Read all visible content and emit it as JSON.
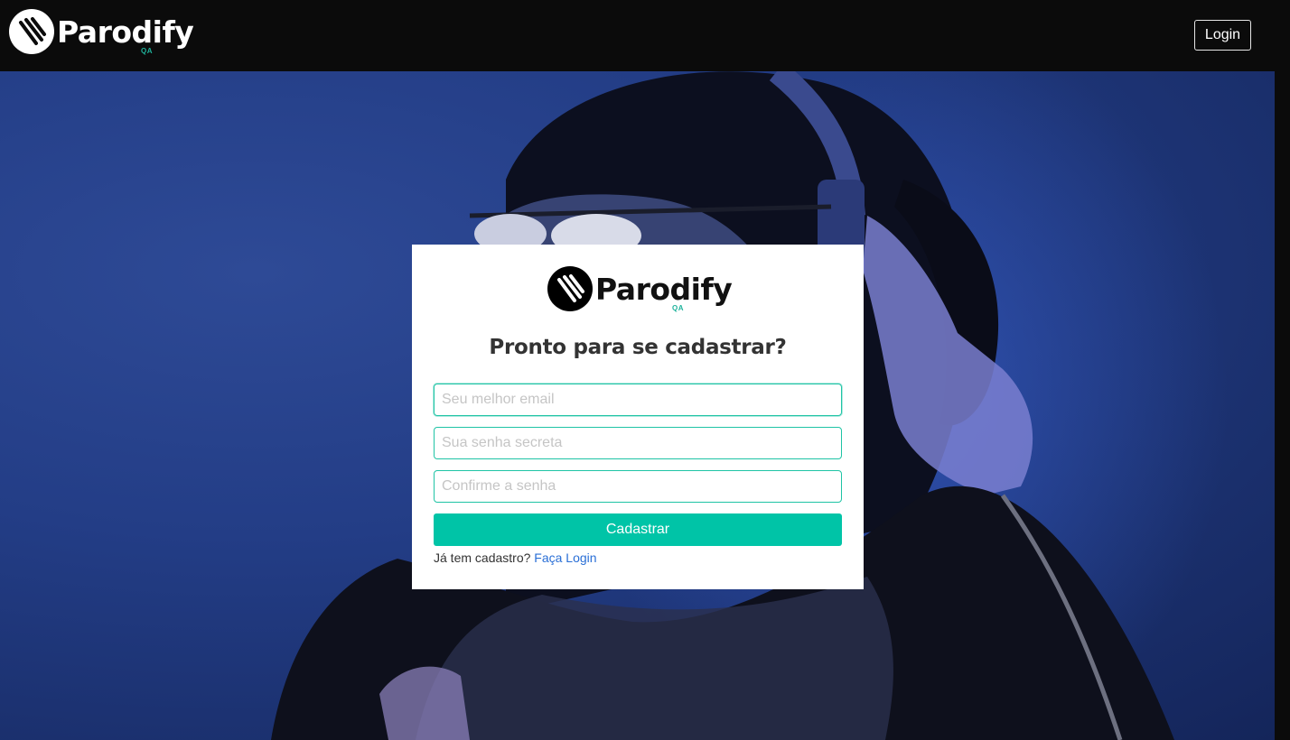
{
  "header": {
    "brand": "Parodify",
    "brand_tag": "QA",
    "login_label": "Login"
  },
  "form": {
    "brand": "Parodify",
    "brand_tag": "QA",
    "title": "Pronto para se cadastrar?",
    "email_placeholder": "Seu melhor email",
    "password_placeholder": "Sua senha secreta",
    "confirm_placeholder": "Confirme a senha",
    "email_value": "",
    "password_value": "",
    "confirm_value": "",
    "submit_label": "Cadastrar",
    "login_prompt": "Já tem cadastro?",
    "login_link": "Faça Login"
  },
  "colors": {
    "accent": "#00c4a7",
    "link": "#2a6fd6",
    "header_bg": "#0b0b0b",
    "hero_bg": "#233d86"
  },
  "icons": {
    "brand_logo": "parodify-logo-icon"
  }
}
